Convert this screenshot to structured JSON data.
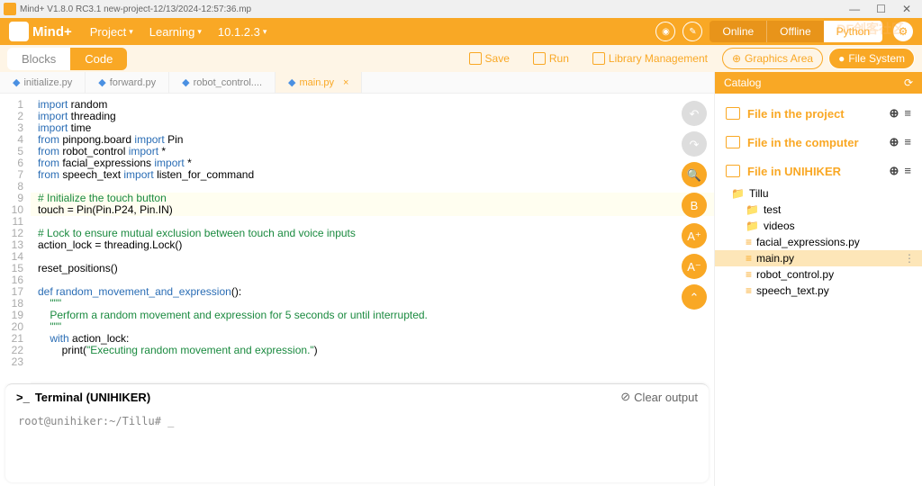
{
  "titlebar": {
    "text": "Mind+ V1.8.0 RC3.1    new-project-12/13/2024-12:57:36.mp"
  },
  "menu": {
    "project": "Project",
    "learning": "Learning",
    "ip": "10.1.2.3"
  },
  "status": {
    "online": "Online",
    "offline": "Offline",
    "python": "Python"
  },
  "watermark": "DF创客社区",
  "tabs": {
    "blocks": "Blocks",
    "code": "Code"
  },
  "actions": {
    "save": "Save",
    "run": "Run",
    "lib": "Library Management",
    "graphics": "Graphics Area",
    "files": "File System"
  },
  "filetabs": [
    {
      "name": "initialize.py"
    },
    {
      "name": "forward.py"
    },
    {
      "name": "robot_control...."
    },
    {
      "name": "main.py",
      "active": true
    }
  ],
  "code": {
    "lines": [
      {
        "n": 1,
        "html": "<span class='kw'>import</span> random"
      },
      {
        "n": 2,
        "html": "<span class='kw'>import</span> threading"
      },
      {
        "n": 3,
        "html": "<span class='kw'>import</span> time"
      },
      {
        "n": 4,
        "html": "<span class='kw'>from</span> pinpong.board <span class='kw'>import</span> Pin"
      },
      {
        "n": 5,
        "html": "<span class='kw'>from</span> robot_control <span class='kw'>import</span> *"
      },
      {
        "n": 6,
        "html": "<span class='kw'>from</span> facial_expressions <span class='kw'>import</span> *"
      },
      {
        "n": 7,
        "html": "<span class='kw'>from</span> speech_text <span class='kw'>import</span> listen_for_command"
      },
      {
        "n": 8,
        "html": ""
      },
      {
        "n": 9,
        "html": "<span class='cmt'># Initialize the touch button</span>",
        "hl": true
      },
      {
        "n": 10,
        "html": "touch = Pin(Pin.P24, Pin.IN)",
        "hl": true
      },
      {
        "n": 11,
        "html": ""
      },
      {
        "n": 12,
        "html": "<span class='cmt'># Lock to ensure mutual exclusion between touch and voice inputs</span>"
      },
      {
        "n": 13,
        "html": "action_lock = threading.Lock()"
      },
      {
        "n": 14,
        "html": ""
      },
      {
        "n": 15,
        "html": "reset_positions()"
      },
      {
        "n": 16,
        "html": ""
      },
      {
        "n": 17,
        "html": "<span class='kw'>def</span> <span class='fn'>random_movement_and_expression</span>():"
      },
      {
        "n": 18,
        "html": "    <span class='str'>\"\"\"</span>"
      },
      {
        "n": 19,
        "html": "<span class='str'>    Perform a random movement and expression for 5 seconds or until interrupted.</span>"
      },
      {
        "n": 20,
        "html": "    <span class='str'>\"\"\"</span>"
      },
      {
        "n": 21,
        "html": "    <span class='kw'>with</span> action_lock:"
      },
      {
        "n": 22,
        "html": "        print(<span class='str'>\"Executing random movement and expression.\"</span>)"
      },
      {
        "n": 23,
        "html": ""
      }
    ]
  },
  "sidebtn_labels": {
    "b": "B",
    "ap": "A⁺",
    "am": "A⁻"
  },
  "terminal": {
    "title": "Terminal (UNIHIKER)",
    "clear": "Clear output",
    "prompt": "root@unihiker:~/Tillu# _"
  },
  "catalog": {
    "title": "Catalog",
    "sections": [
      {
        "label": "File in the project"
      },
      {
        "label": "File in the computer"
      },
      {
        "label": "File in UNIHIKER"
      }
    ],
    "tree": [
      {
        "label": "Tillu",
        "type": "folder",
        "indent": 1
      },
      {
        "label": "test",
        "type": "folder",
        "indent": 2
      },
      {
        "label": "videos",
        "type": "folder",
        "indent": 2
      },
      {
        "label": "facial_expressions.py",
        "type": "file",
        "indent": 2
      },
      {
        "label": "main.py",
        "type": "file",
        "indent": 2,
        "sel": true
      },
      {
        "label": "robot_control.py",
        "type": "file",
        "indent": 2
      },
      {
        "label": "speech_text.py",
        "type": "file",
        "indent": 2
      }
    ]
  }
}
